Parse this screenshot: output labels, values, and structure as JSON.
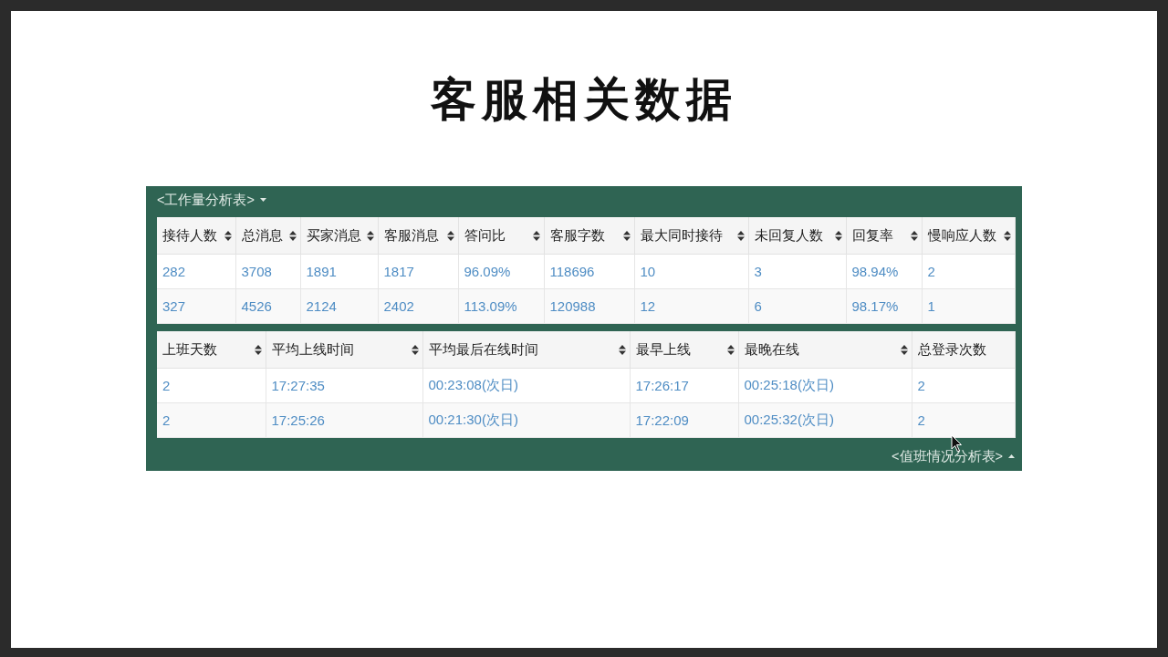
{
  "slide": {
    "title": "客服相关数据"
  },
  "panel": {
    "header_link": "<工作量分析表>",
    "header_expanded": false,
    "footer_link": "<值班情况分析表>",
    "footer_expanded": true
  },
  "tables": [
    {
      "columns": [
        {
          "label": "接待人数",
          "sortable": true
        },
        {
          "label": "总消息",
          "sortable": true
        },
        {
          "label": "买家消息",
          "sortable": true
        },
        {
          "label": "客服消息",
          "sortable": true
        },
        {
          "label": "答问比",
          "sortable": true
        },
        {
          "label": "客服字数",
          "sortable": true
        },
        {
          "label": "最大同时接待",
          "sortable": true
        },
        {
          "label": "未回复人数",
          "sortable": true
        },
        {
          "label": "回复率",
          "sortable": true
        },
        {
          "label": "慢响应人数",
          "sortable": true
        }
      ],
      "rows": [
        [
          "282",
          "3708",
          "1891",
          "1817",
          "96.09%",
          "118696",
          "10",
          "3",
          "98.94%",
          "2"
        ],
        [
          "327",
          "4526",
          "2124",
          "2402",
          "113.09%",
          "120988",
          "12",
          "6",
          "98.17%",
          "1"
        ]
      ]
    },
    {
      "columns": [
        {
          "label": "上班天数",
          "sortable": true
        },
        {
          "label": "平均上线时间",
          "sortable": true
        },
        {
          "label": "平均最后在线时间",
          "sortable": true
        },
        {
          "label": "最早上线",
          "sortable": true
        },
        {
          "label": "最晚在线",
          "sortable": true
        },
        {
          "label": "总登录次数",
          "sortable": false
        }
      ],
      "rows": [
        [
          "2",
          "17:27:35",
          "00:23:08(次日)",
          "17:26:17",
          "00:25:18(次日)",
          "2"
        ],
        [
          "2",
          "17:25:26",
          "00:21:30(次日)",
          "17:22:09",
          "00:25:32(次日)",
          "2"
        ]
      ]
    }
  ]
}
